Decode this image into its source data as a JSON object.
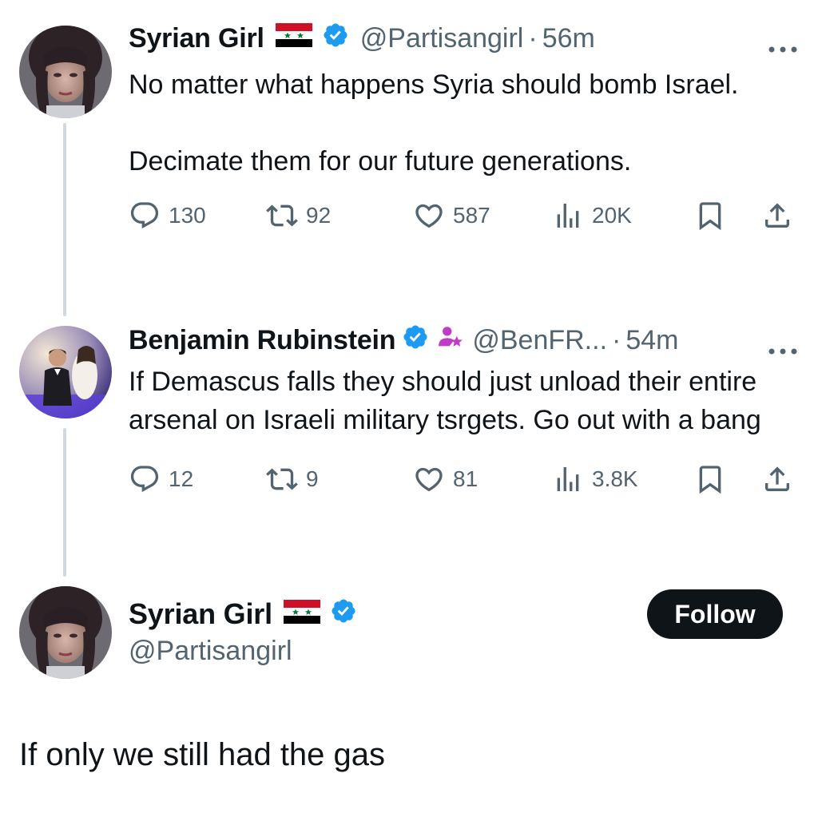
{
  "thread": [
    {
      "display_name": "Syrian Girl",
      "flag": "syria-flag",
      "verified": true,
      "handle": "@Partisangirl",
      "separator": "·",
      "time": "56m",
      "text": "No matter what happens Syria should bomb Israel.\n\nDecimate them for our future generations.",
      "metrics": {
        "replies": "130",
        "reposts": "92",
        "likes": "587",
        "views": "20K"
      }
    },
    {
      "display_name": "Benjamin Rubinstein",
      "verified": true,
      "badge": "subscriber-badge-icon",
      "handle": "@BenFR...",
      "separator": "·",
      "time": "54m",
      "text": "If Demascus falls they should just unload their entire arsenal on Israeli military tsrgets. Go out with a bang",
      "metrics": {
        "replies": "12",
        "reposts": "9",
        "likes": "81",
        "views": "3.8K"
      }
    }
  ],
  "focus_tweet": {
    "display_name": "Syrian Girl",
    "flag": "syria-flag",
    "verified": true,
    "handle": "@Partisangirl",
    "follow_label": "Follow",
    "text": "If only we still had the gas"
  },
  "colors": {
    "text": "#0f1419",
    "secondary": "#536471",
    "verified_blue": "#1d9bf0",
    "thread_line": "#cfd9de",
    "follow_bg": "#0f1419",
    "subscriber_pink": "#c13ac8"
  }
}
